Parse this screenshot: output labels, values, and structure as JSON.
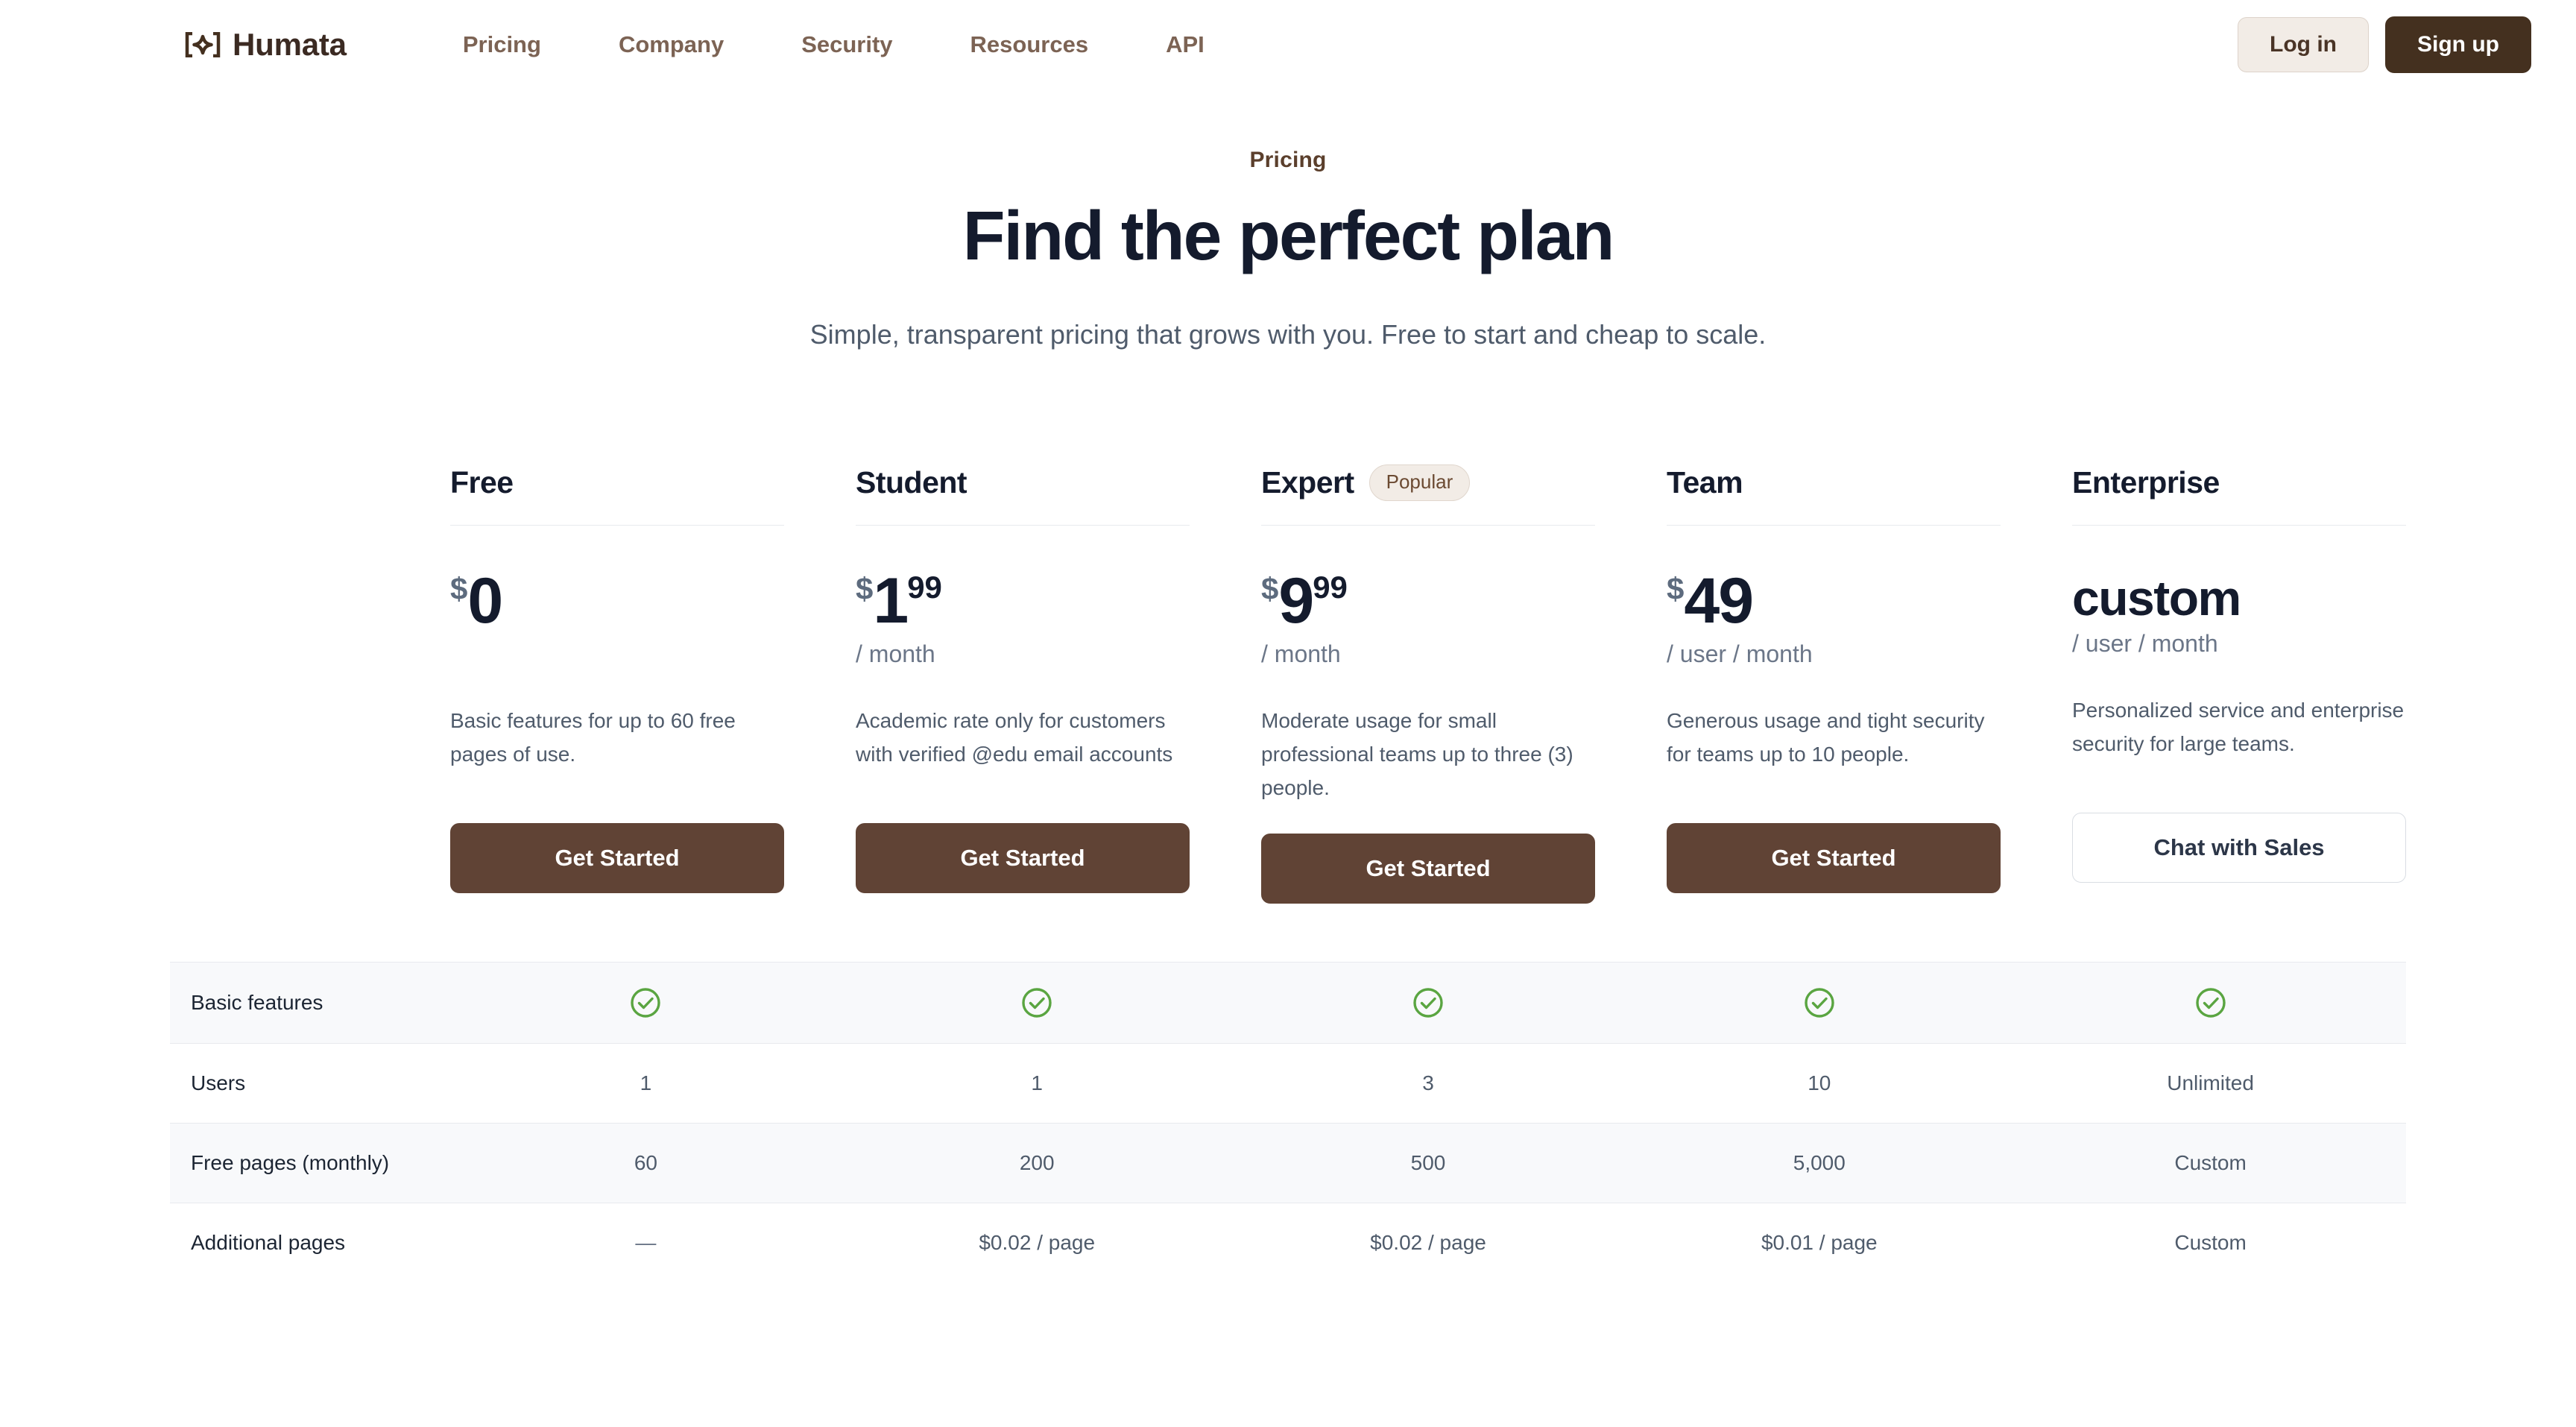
{
  "brand": {
    "name": "Humata",
    "icon": "humata-diamond-bracket-logo"
  },
  "nav": {
    "links": [
      {
        "label": "Pricing"
      },
      {
        "label": "Company"
      },
      {
        "label": "Security"
      },
      {
        "label": "Resources"
      },
      {
        "label": "API"
      }
    ],
    "login_label": "Log in",
    "signup_label": "Sign up"
  },
  "hero": {
    "eyebrow": "Pricing",
    "title": "Find the perfect plan",
    "subtitle": "Simple, transparent pricing that grows with you. Free to start and cheap to scale."
  },
  "plans": [
    {
      "name": "Free",
      "badge": "",
      "currency": "$",
      "amount": "0",
      "cents": "",
      "period": "",
      "description": "Basic features for up to 60 free pages of use.",
      "cta": "Get Started",
      "cta_style": "primary"
    },
    {
      "name": "Student",
      "badge": "",
      "currency": "$",
      "amount": "1",
      "cents": "99",
      "period": "/ month",
      "description": "Academic rate only for customers with verified @edu email accounts",
      "cta": "Get Started",
      "cta_style": "primary"
    },
    {
      "name": "Expert",
      "badge": "Popular",
      "currency": "$",
      "amount": "9",
      "cents": "99",
      "period": "/ month",
      "description": "Moderate usage for small professional teams up to three (3) people.",
      "cta": "Get Started",
      "cta_style": "primary"
    },
    {
      "name": "Team",
      "badge": "",
      "currency": "$",
      "amount": "49",
      "cents": "",
      "period": "/ user / month",
      "description": "Generous usage and tight security for teams up to 10 people.",
      "cta": "Get Started",
      "cta_style": "primary"
    },
    {
      "name": "Enterprise",
      "badge": "",
      "currency": "",
      "amount": "custom",
      "cents": "",
      "period": "/ user / month",
      "description": "Personalized service and enterprise security for large teams.",
      "cta": "Chat with Sales",
      "cta_style": "ghost"
    }
  ],
  "comparison": {
    "rows": [
      {
        "label": "Basic features",
        "shaded": true,
        "values": [
          "check",
          "check",
          "check",
          "check",
          "check"
        ]
      },
      {
        "label": "Users",
        "shaded": false,
        "values": [
          "1",
          "1",
          "3",
          "10",
          "Unlimited"
        ]
      },
      {
        "label": "Free pages (monthly)",
        "shaded": true,
        "values": [
          "60",
          "200",
          "500",
          "5,000",
          "Custom"
        ]
      },
      {
        "label": "Additional pages",
        "shaded": false,
        "values": [
          "—",
          "$0.02 / page",
          "$0.02 / page",
          "$0.01 / page",
          "Custom"
        ]
      }
    ]
  },
  "colors": {
    "brand_brown": "#44301f",
    "cta_brown": "#604335",
    "nav_link": "#7c6354",
    "heading_navy": "#141b2d",
    "body_gray": "#4f5b6b",
    "check_green": "#5aa541",
    "row_shade": "#f8f9fb"
  }
}
